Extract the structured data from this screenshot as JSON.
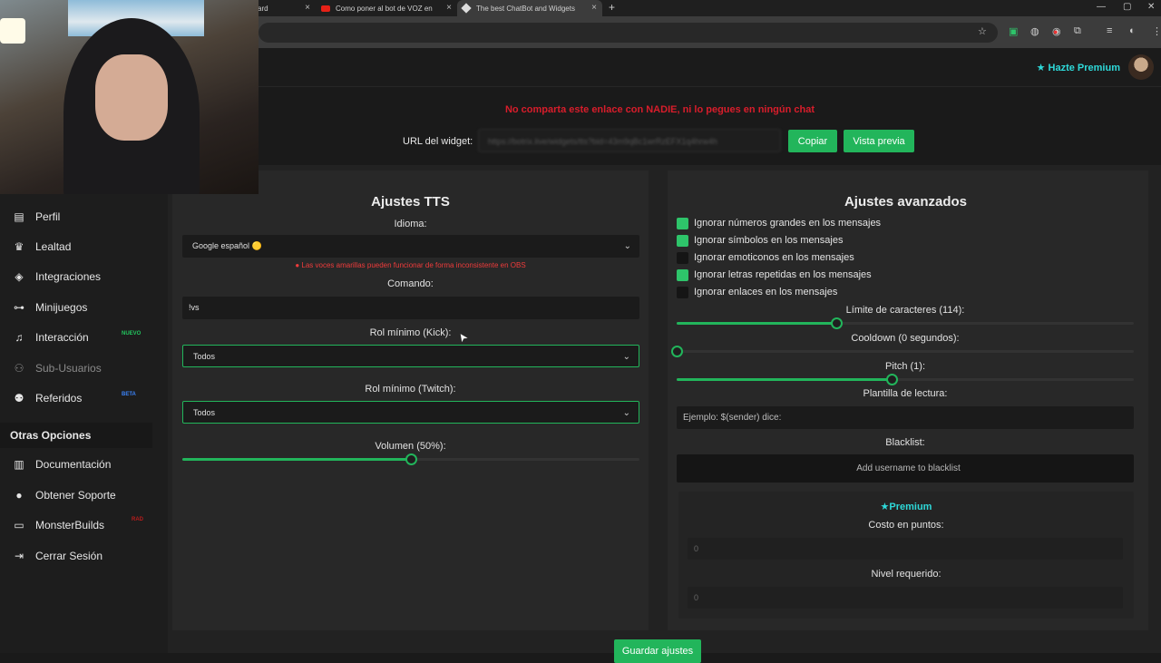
{
  "browser": {
    "tabs": [
      {
        "label": "ard",
        "active": false
      },
      {
        "label": "Como poner al bot de VOZ en",
        "active": false
      },
      {
        "label": "The best ChatBot and Widgets",
        "active": true
      }
    ],
    "new_tab": "+",
    "close_glyph": "×"
  },
  "header": {
    "premium_label": "Hazte Premium"
  },
  "sidebar": {
    "items": [
      {
        "label": "Perfil",
        "icon": "id-card-icon"
      },
      {
        "label": "Lealtad",
        "icon": "trophy-icon"
      },
      {
        "label": "Integraciones",
        "icon": "layers-icon"
      },
      {
        "label": "Minijuegos",
        "icon": "gamepad-icon"
      },
      {
        "label": "Interacción",
        "icon": "music-icon",
        "badge": "NUEVO",
        "badge_color": "#22c55e"
      },
      {
        "label": "Sub-Usuarios",
        "icon": "users-icon",
        "disabled": true
      },
      {
        "label": "Referidos",
        "icon": "users-group-icon",
        "badge": "BETA",
        "badge_color": "#3b82f6"
      }
    ],
    "other_header": "Otras Opciones",
    "other_items": [
      {
        "label": "Documentación",
        "icon": "book-icon"
      },
      {
        "label": "Obtener Soporte",
        "icon": "help-circle-icon"
      },
      {
        "label": "MonsterBuilds",
        "icon": "monitor-icon",
        "badge": "RAD",
        "badge_color": "#b91c1c"
      },
      {
        "label": "Cerrar Sesión",
        "icon": "logout-icon"
      }
    ]
  },
  "widget": {
    "warning": "No comparta este enlace con NADIE, ni lo pegues en ningún chat",
    "url_label": "URL del widget:",
    "url_value": "https://botrix.live/widgets/tts?bid=43m9qBc1wrRzEFX1q4hrw4h",
    "copy_label": "Copiar",
    "preview_label": "Vista previa"
  },
  "tts": {
    "title": "Ajustes TTS",
    "language_label": "Idioma:",
    "language_value": "Google español 🟡",
    "language_warning": "Las voces amarillas pueden funcionar de forma inconsistente en OBS",
    "command_label": "Comando:",
    "command_value": "!vs",
    "role_kick_label": "Rol mínimo (Kick):",
    "role_kick_value": "Todos",
    "role_twitch_label": "Rol mínimo (Twitch):",
    "role_twitch_value": "Todos",
    "volume_label": "Volumen (50%):",
    "volume_fraction": 0.5
  },
  "advanced": {
    "title": "Ajustes avanzados",
    "options": [
      {
        "label": "Ignorar números grandes en los mensajes",
        "checked": true
      },
      {
        "label": "Ignorar símbolos en los mensajes",
        "checked": true
      },
      {
        "label": "Ignorar emoticonos en los mensajes",
        "checked": false
      },
      {
        "label": "Ignorar letras repetidas en los mensajes",
        "checked": true
      },
      {
        "label": "Ignorar enlaces en los mensajes",
        "checked": false
      }
    ],
    "char_limit_label": "Límite de caracteres (114):",
    "char_limit_fraction": 0.35,
    "cooldown_label": "Cooldown (0 segundos):",
    "cooldown_fraction": 0,
    "pitch_label": "Pitch (1):",
    "pitch_fraction": 0.47,
    "template_label": "Plantilla de lectura:",
    "template_placeholder": "Ejemplo: $(sender) dice:",
    "blacklist_label": "Blacklist:",
    "blacklist_placeholder": "Add username to blacklist"
  },
  "premium": {
    "title": "Premium",
    "cost_label": "Costo en puntos:",
    "cost_value": "0",
    "level_label": "Nivel requerido:",
    "level_value": "0"
  },
  "save_label": "Guardar ajustes",
  "colors": {
    "accent": "#22b55b",
    "warning": "#d81d2b",
    "premium": "#2ed9d9"
  }
}
